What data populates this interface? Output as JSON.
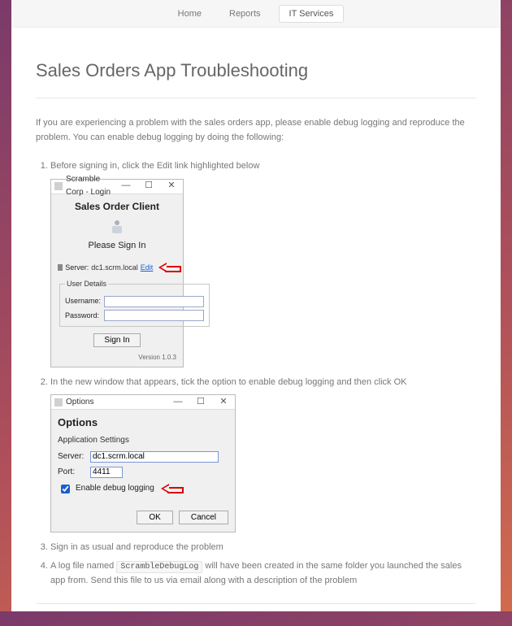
{
  "nav": {
    "items": [
      {
        "label": "Home",
        "active": false
      },
      {
        "label": "Reports",
        "active": false
      },
      {
        "label": "IT Services",
        "active": true
      }
    ]
  },
  "title": "Sales Orders App Troubleshooting",
  "intro": "If you are experiencing a problem with the sales orders app, please enable debug logging and reproduce the problem. You can enable debug logging by doing the following:",
  "steps": {
    "s1": "Before signing in, click the Edit link highlighted below",
    "s2": "In the new window that appears, tick the option to enable debug logging and then click OK",
    "s3": "Sign in as usual and reproduce the problem",
    "s4a": "A log file named",
    "s4_code": "ScrambleDebugLog",
    "s4b": "will have been created in the same folder you launched the sales app from. Send this file to us via email along with a description of the problem"
  },
  "login_win": {
    "title": "Scramble Corp - Login",
    "app_title": "Sales Order Client",
    "please": "Please Sign In",
    "server_label": "Server:",
    "server_value": "dc1.scrm.local",
    "edit_link": "Edit",
    "user_details_legend": "User Details",
    "username_label": "Username:",
    "password_label": "Password:",
    "signin_btn": "Sign In",
    "version": "Version 1.0.3"
  },
  "options_win": {
    "title": "Options",
    "heading": "Options",
    "subheading": "Application Settings",
    "server_label": "Server:",
    "server_value": "dc1.scrm.local",
    "port_label": "Port:",
    "port_value": "4411",
    "checkbox_label": "Enable debug logging",
    "ok": "OK",
    "cancel": "Cancel"
  }
}
